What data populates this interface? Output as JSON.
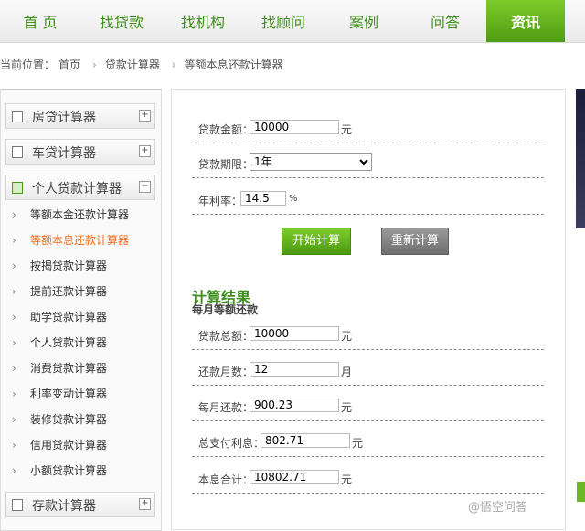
{
  "nav": {
    "items": [
      "首 页",
      "找贷款",
      "找机构",
      "找顾问",
      "案例",
      "问答",
      "资讯"
    ],
    "active_index": 6
  },
  "breadcrumb": {
    "prefix": "当前位置：",
    "home": "首页",
    "level1": "贷款计算器",
    "level2": "等额本息还款计算器"
  },
  "sidebar": {
    "categories": [
      {
        "label": "房贷计算器",
        "toggle": "+"
      },
      {
        "label": "车贷计算器",
        "toggle": "+"
      },
      {
        "label": "个人贷款计算器",
        "toggle": "−"
      },
      {
        "label": "存款计算器",
        "toggle": "+"
      }
    ],
    "subitems": [
      "等额本金还款计算器",
      "等额本息还款计算器",
      "按揭贷款计算器",
      "提前还款计算器",
      "助学贷款计算器",
      "个人贷款计算器",
      "消费贷款计算器",
      "利率变动计算器",
      "装修贷款计算器",
      "信用贷款计算器",
      "小额贷款计算器"
    ],
    "active_sub_index": 1
  },
  "form": {
    "amount_label": "贷款金额：",
    "amount_value": "10000",
    "amount_unit": "元",
    "term_label": "贷款期限：",
    "term_value": "1年",
    "rate_label": "年利率：",
    "rate_value": "14.5",
    "rate_unit": "%",
    "calc_button": "开始计算",
    "reset_button": "重新计算"
  },
  "results": {
    "title": "计算结果",
    "subtitle": "每月等额还款",
    "total_loan_label": "贷款总额：",
    "total_loan_value": "10000",
    "total_loan_unit": "元",
    "months_label": "还款月数：",
    "months_value": "12",
    "months_unit": "月",
    "monthly_label": "每月还款：",
    "monthly_value": "900.23",
    "monthly_unit": "元",
    "interest_label": "总支付利息：",
    "interest_value": "802.71",
    "interest_unit": "元",
    "total_label": "本息合计：",
    "total_value": "10802.71",
    "total_unit": "元"
  },
  "watermark": "@悟空问答",
  "colors": {
    "brand_green": "#4f9d14",
    "nav_text": "#3f8f1d",
    "active_sub": "#f26c1e"
  }
}
